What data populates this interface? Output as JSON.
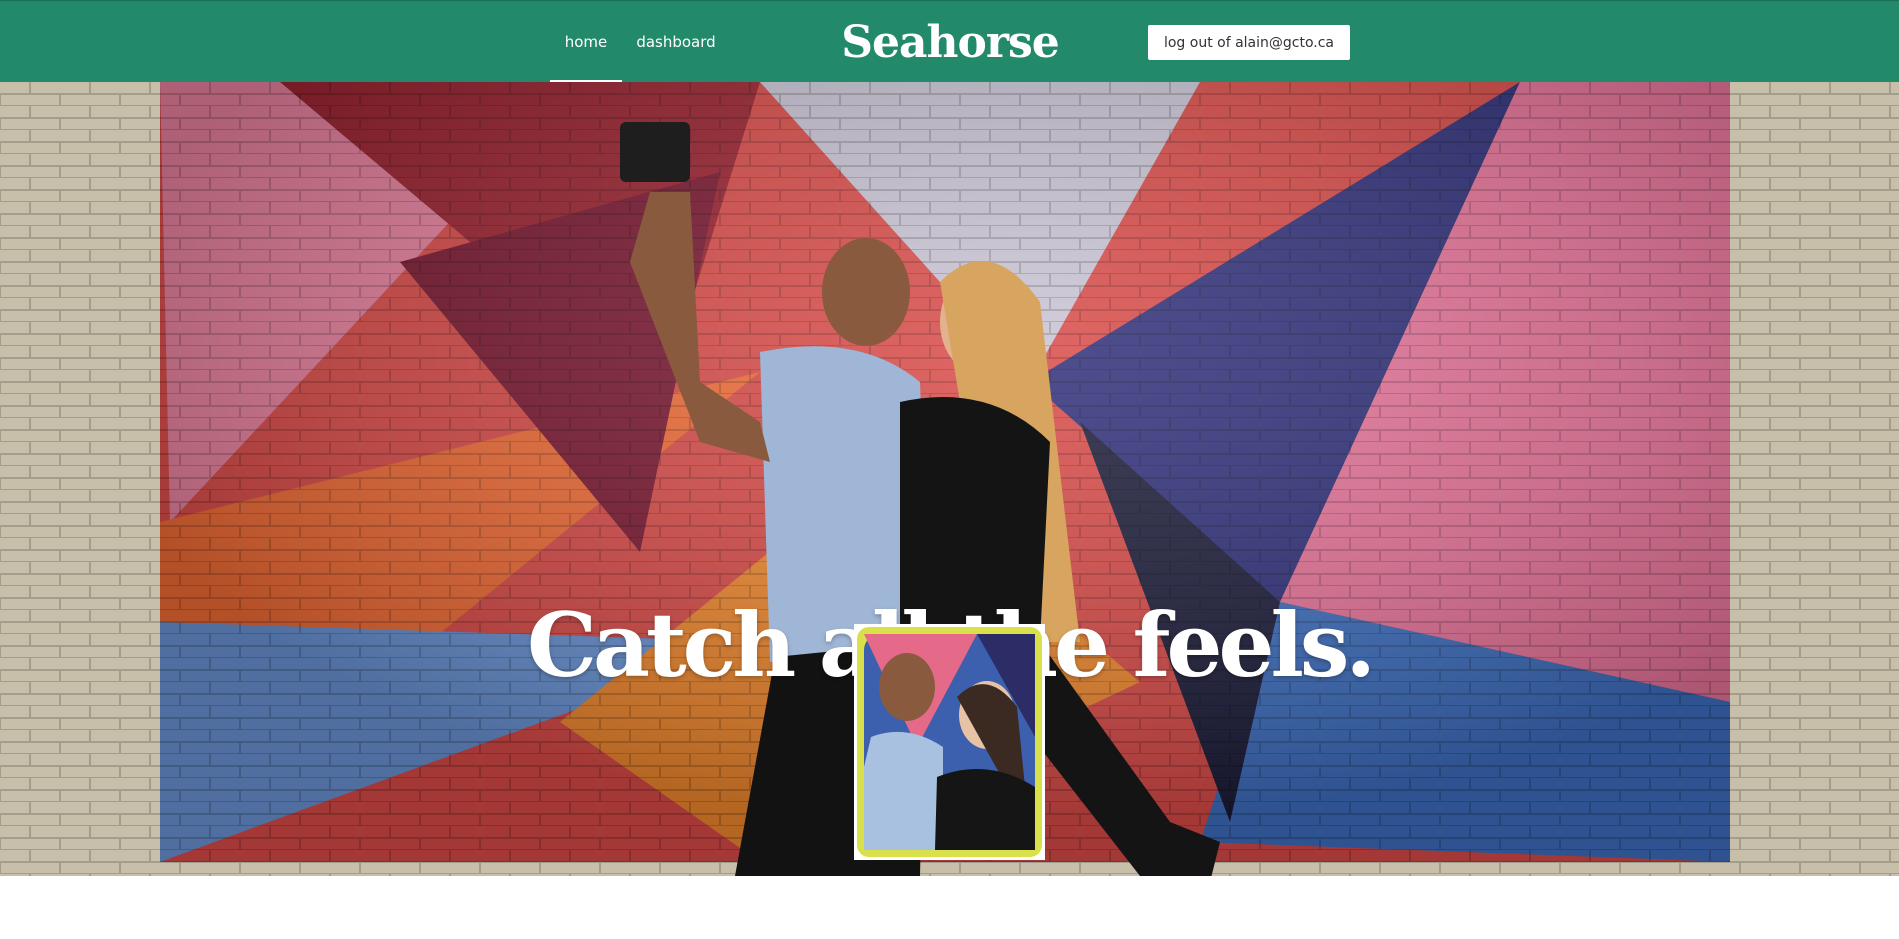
{
  "nav": {
    "home_label": "home",
    "dashboard_label": "dashboard"
  },
  "brand": {
    "title": "Seahorse"
  },
  "account": {
    "logout_label": "log out of alain@gcto.ca"
  },
  "hero": {
    "tagline": "Catch all the feels."
  },
  "colors": {
    "header_bg": "#22896b",
    "text_light": "#ffffff",
    "card_frame": "#d9e04a"
  }
}
